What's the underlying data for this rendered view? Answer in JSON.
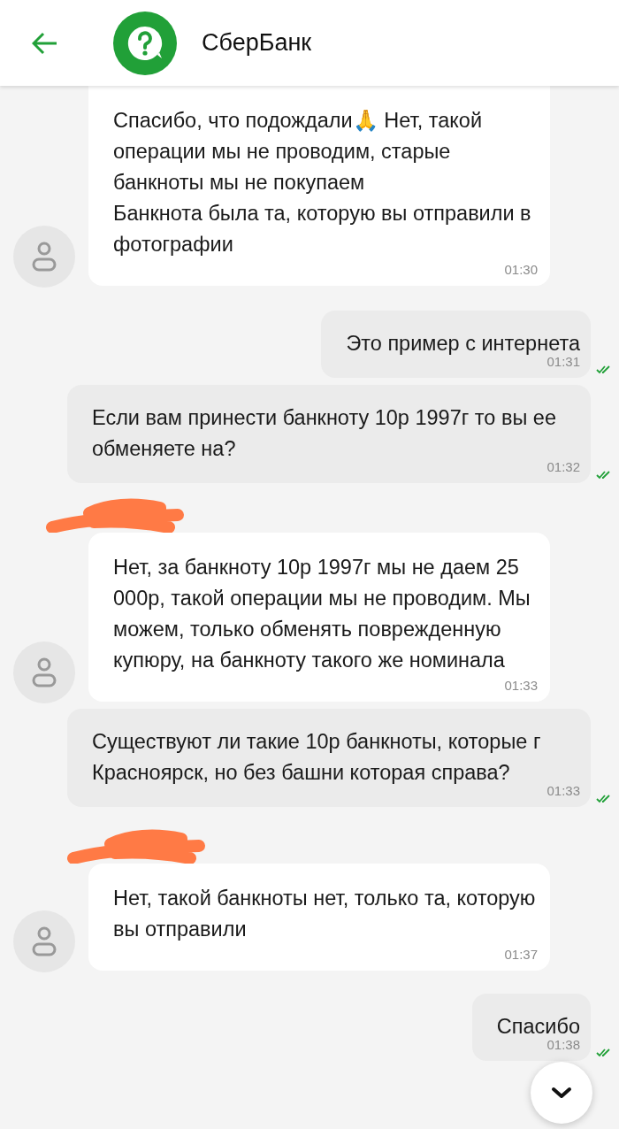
{
  "header": {
    "title": "СберБанк"
  },
  "messages": [
    {
      "kind": "incoming",
      "redacted": false,
      "text": "Спасибо, что подождали🙏 Нет, такой операции мы не проводим, старые банкноты мы не покупаем\nБанкнота была та, которую вы отправили в фотографии",
      "time": "01:30"
    },
    {
      "kind": "outgoing",
      "text": "Это пример с интернета",
      "time": "01:31",
      "read": true
    },
    {
      "kind": "outgoing",
      "text": "Если вам принести банкноту 10р 1997г то вы ее обменяете на?",
      "time": "01:32",
      "read": true
    },
    {
      "kind": "incoming",
      "redacted": true,
      "text": "Нет, за банкноту 10р 1997г мы не даем 25 000р, такой операции мы не проводим. Мы можем, только обменять поврежденную купюру, на банкноту такого же номинала",
      "time": "01:33"
    },
    {
      "kind": "outgoing",
      "text": "Существуют ли такие 10р банкноты, которые г Красноярск, но без башни которая справа?",
      "time": "01:33",
      "read": true
    },
    {
      "kind": "incoming",
      "redacted": true,
      "text": "Нет, такой банкноты нет, только та, которую вы отправили",
      "time": "01:37"
    },
    {
      "kind": "outgoing",
      "text": "Спасибо",
      "time": "01:38",
      "read": true
    }
  ]
}
